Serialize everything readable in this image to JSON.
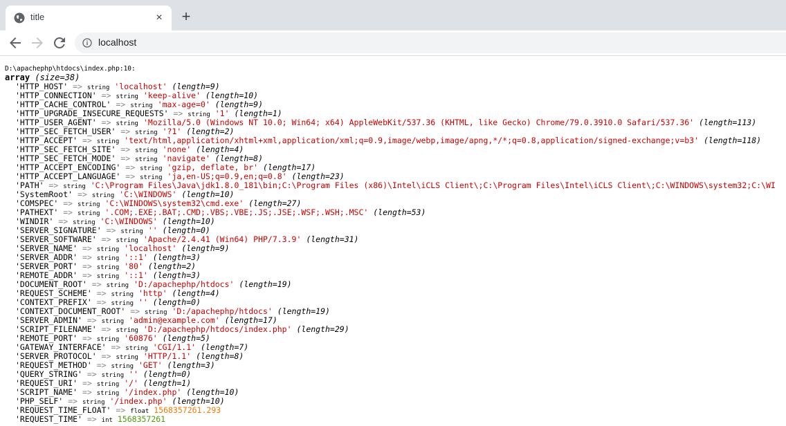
{
  "browser": {
    "tab_title": "title",
    "tab_close": "×",
    "new_tab": "+",
    "url": "localhost"
  },
  "dump": {
    "file_line": "D:\\apachephp\\htdocs\\index.php:10:",
    "array_label": "array",
    "array_size": "(size=38)",
    "arrow": "=>",
    "rows": [
      {
        "key": "'HTTP_HOST'",
        "type": "string",
        "value": "'localhost'",
        "kind": "s",
        "len": "(length=9)"
      },
      {
        "key": "'HTTP_CONNECTION'",
        "type": "string",
        "value": "'keep-alive'",
        "kind": "s",
        "len": "(length=10)"
      },
      {
        "key": "'HTTP_CACHE_CONTROL'",
        "type": "string",
        "value": "'max-age=0'",
        "kind": "s",
        "len": "(length=9)"
      },
      {
        "key": "'HTTP_UPGRADE_INSECURE_REQUESTS'",
        "type": "string",
        "value": "'1'",
        "kind": "s",
        "len": "(length=1)"
      },
      {
        "key": "'HTTP_USER_AGENT'",
        "type": "string",
        "value": "'Mozilla/5.0 (Windows NT 10.0; Win64; x64) AppleWebKit/537.36 (KHTML, like Gecko) Chrome/79.0.3910.0 Safari/537.36'",
        "kind": "s",
        "len": "(length=113)"
      },
      {
        "key": "'HTTP_SEC_FETCH_USER'",
        "type": "string",
        "value": "'?1'",
        "kind": "s",
        "len": "(length=2)"
      },
      {
        "key": "'HTTP_ACCEPT'",
        "type": "string",
        "value": "'text/html,application/xhtml+xml,application/xml;q=0.9,image/webp,image/apng,*/*;q=0.8,application/signed-exchange;v=b3'",
        "kind": "s",
        "len": "(length=118)"
      },
      {
        "key": "'HTTP_SEC_FETCH_SITE'",
        "type": "string",
        "value": "'none'",
        "kind": "s",
        "len": "(length=4)"
      },
      {
        "key": "'HTTP_SEC_FETCH_MODE'",
        "type": "string",
        "value": "'navigate'",
        "kind": "s",
        "len": "(length=8)"
      },
      {
        "key": "'HTTP_ACCEPT_ENCODING'",
        "type": "string",
        "value": "'gzip, deflate, br'",
        "kind": "s",
        "len": "(length=17)"
      },
      {
        "key": "'HTTP_ACCEPT_LANGUAGE'",
        "type": "string",
        "value": "'ja,en-US;q=0.9,en;q=0.8'",
        "kind": "s",
        "len": "(length=23)"
      },
      {
        "key": "'PATH'",
        "type": "string",
        "value": "'C:\\Program Files\\Java\\jdk1.8.0_181\\bin;C:\\Program Files (x86)\\Intel\\iCLS Client\\;C:\\Program Files\\Intel\\iCLS Client\\;C:\\WINDOWS\\system32;C:\\WI",
        "kind": "s",
        "len": ""
      },
      {
        "key": "'SystemRoot'",
        "type": "string",
        "value": "'C:\\WINDOWS'",
        "kind": "s",
        "len": "(length=10)"
      },
      {
        "key": "'COMSPEC'",
        "type": "string",
        "value": "'C:\\WINDOWS\\system32\\cmd.exe'",
        "kind": "s",
        "len": "(length=27)"
      },
      {
        "key": "'PATHEXT'",
        "type": "string",
        "value": "'.COM;.EXE;.BAT;.CMD;.VBS;.VBE;.JS;.JSE;.WSF;.WSH;.MSC'",
        "kind": "s",
        "len": "(length=53)"
      },
      {
        "key": "'WINDIR'",
        "type": "string",
        "value": "'C:\\WINDOWS'",
        "kind": "s",
        "len": "(length=10)"
      },
      {
        "key": "'SERVER_SIGNATURE'",
        "type": "string",
        "value": "''",
        "kind": "s",
        "len": "(length=0)"
      },
      {
        "key": "'SERVER_SOFTWARE'",
        "type": "string",
        "value": "'Apache/2.4.41 (Win64) PHP/7.3.9'",
        "kind": "s",
        "len": "(length=31)"
      },
      {
        "key": "'SERVER_NAME'",
        "type": "string",
        "value": "'localhost'",
        "kind": "s",
        "len": "(length=9)"
      },
      {
        "key": "'SERVER_ADDR'",
        "type": "string",
        "value": "'::1'",
        "kind": "s",
        "len": "(length=3)"
      },
      {
        "key": "'SERVER_PORT'",
        "type": "string",
        "value": "'80'",
        "kind": "s",
        "len": "(length=2)"
      },
      {
        "key": "'REMOTE_ADDR'",
        "type": "string",
        "value": "'::1'",
        "kind": "s",
        "len": "(length=3)"
      },
      {
        "key": "'DOCUMENT_ROOT'",
        "type": "string",
        "value": "'D:/apachephp/htdocs'",
        "kind": "s",
        "len": "(length=19)"
      },
      {
        "key": "'REQUEST_SCHEME'",
        "type": "string",
        "value": "'http'",
        "kind": "s",
        "len": "(length=4)"
      },
      {
        "key": "'CONTEXT_PREFIX'",
        "type": "string",
        "value": "''",
        "kind": "s",
        "len": "(length=0)"
      },
      {
        "key": "'CONTEXT_DOCUMENT_ROOT'",
        "type": "string",
        "value": "'D:/apachephp/htdocs'",
        "kind": "s",
        "len": "(length=19)"
      },
      {
        "key": "'SERVER_ADMIN'",
        "type": "string",
        "value": "'admin@example.com'",
        "kind": "s",
        "len": "(length=17)"
      },
      {
        "key": "'SCRIPT_FILENAME'",
        "type": "string",
        "value": "'D:/apachephp/htdocs/index.php'",
        "kind": "s",
        "len": "(length=29)"
      },
      {
        "key": "'REMOTE_PORT'",
        "type": "string",
        "value": "'60876'",
        "kind": "s",
        "len": "(length=5)"
      },
      {
        "key": "'GATEWAY_INTERFACE'",
        "type": "string",
        "value": "'CGI/1.1'",
        "kind": "s",
        "len": "(length=7)"
      },
      {
        "key": "'SERVER_PROTOCOL'",
        "type": "string",
        "value": "'HTTP/1.1'",
        "kind": "s",
        "len": "(length=8)"
      },
      {
        "key": "'REQUEST_METHOD'",
        "type": "string",
        "value": "'GET'",
        "kind": "s",
        "len": "(length=3)"
      },
      {
        "key": "'QUERY_STRING'",
        "type": "string",
        "value": "''",
        "kind": "s",
        "len": "(length=0)"
      },
      {
        "key": "'REQUEST_URI'",
        "type": "string",
        "value": "'/'",
        "kind": "s",
        "len": "(length=1)"
      },
      {
        "key": "'SCRIPT_NAME'",
        "type": "string",
        "value": "'/index.php'",
        "kind": "s",
        "len": "(length=10)"
      },
      {
        "key": "'PHP_SELF'",
        "type": "string",
        "value": "'/index.php'",
        "kind": "s",
        "len": "(length=10)"
      },
      {
        "key": "'REQUEST_TIME_FLOAT'",
        "type": "float",
        "value": "1568357261.293",
        "kind": "f",
        "len": ""
      },
      {
        "key": "'REQUEST_TIME'",
        "type": "int",
        "value": "1568357261",
        "kind": "i",
        "len": ""
      }
    ]
  }
}
